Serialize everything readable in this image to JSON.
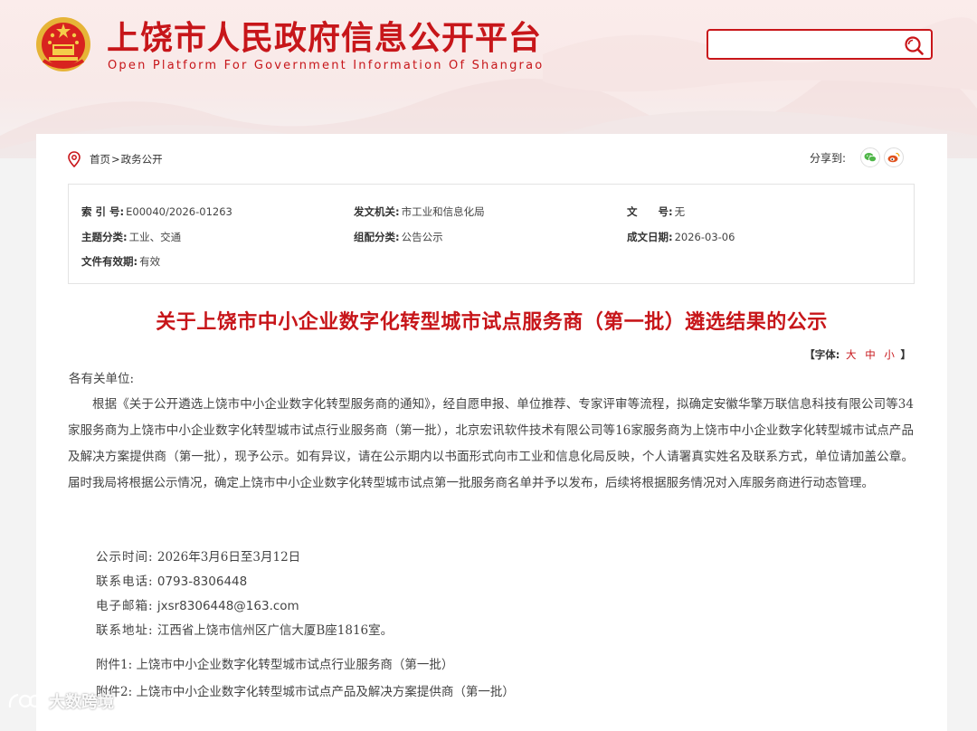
{
  "header": {
    "title": "上饶市人民政府信息公开平台",
    "subtitle": "Open Platform For Government Information Of Shangrao",
    "search": {
      "placeholder": "",
      "value": ""
    }
  },
  "breadcrumb": {
    "home": "首页",
    "separator": ">",
    "section": "政务公开"
  },
  "share": {
    "label": "分享到:"
  },
  "meta": {
    "index_no": {
      "label": "索 引 号:",
      "value": "E00040/2026-01263"
    },
    "issuer": {
      "label": "发文机关:",
      "value": "市工业和信息化局"
    },
    "doc_no": {
      "label": "文　　号:",
      "value": "无"
    },
    "topic": {
      "label": "主题分类:",
      "value": "工业、交通"
    },
    "category": {
      "label": "组配分类:",
      "value": "公告公示"
    },
    "date": {
      "label": "成文日期:",
      "value": "2026-03-06"
    },
    "validity": {
      "label": "文件有效期:",
      "value": "有效"
    }
  },
  "article": {
    "title": "关于上饶市中小企业数字化转型城市试点服务商（第一批）遴选结果的公示",
    "font_size": {
      "prefix": "【字体:",
      "large": "大",
      "medium": "中",
      "small": "小",
      "suffix": "】"
    },
    "salutation": "各有关单位:",
    "paragraph": "根据《关于公开遴选上饶市中小企业数字化转型服务商的通知》，经自愿申报、单位推荐、专家评审等流程，拟确定安徽华擎万联信息科技有限公司等34家服务商为上饶市中小企业数字化转型城市试点行业服务商（第一批），北京宏讯软件技术有限公司等16家服务商为上饶市中小企业数字化转型城市试点产品及解决方案提供商（第一批），现予公示。如有异议，请在公示期内以书面形式向市工业和信息化局反映，个人请署真实姓名及联系方式，单位请加盖公章。届时我局将根据公示情况，确定上饶市中小企业数字化转型城市试点第一批服务商名单并予以发布，后续将根据服务情况对入库服务商进行动态管理。",
    "period": {
      "label": "公示时间:",
      "value": "2026年3月6日至3月12日"
    },
    "phone": {
      "label": "联系电话:",
      "value": "0793-8306448"
    },
    "email": {
      "label": "电子邮箱:",
      "value": "jxsr8306448@163.com"
    },
    "address": {
      "label": "联系地址:",
      "value": "江西省上饶市信州区广信大厦B座1816室。"
    },
    "attachment1": {
      "label": "附件1:",
      "value": "上饶市中小企业数字化转型城市试点行业服务商（第一批）"
    },
    "attachment2": {
      "label": "附件2:",
      "value": "上饶市中小企业数字化转型城市试点产品及解决方案提供商（第一批）"
    }
  },
  "watermark": {
    "text": "大数跨境"
  },
  "colors": {
    "accent": "#c7161a",
    "wechat": "#4fb648",
    "weibo": "#e0521e"
  },
  "icons": [
    "national-emblem-icon",
    "search-icon",
    "location-pin-icon",
    "wechat-icon",
    "weibo-icon",
    "watermark-logo-icon"
  ]
}
